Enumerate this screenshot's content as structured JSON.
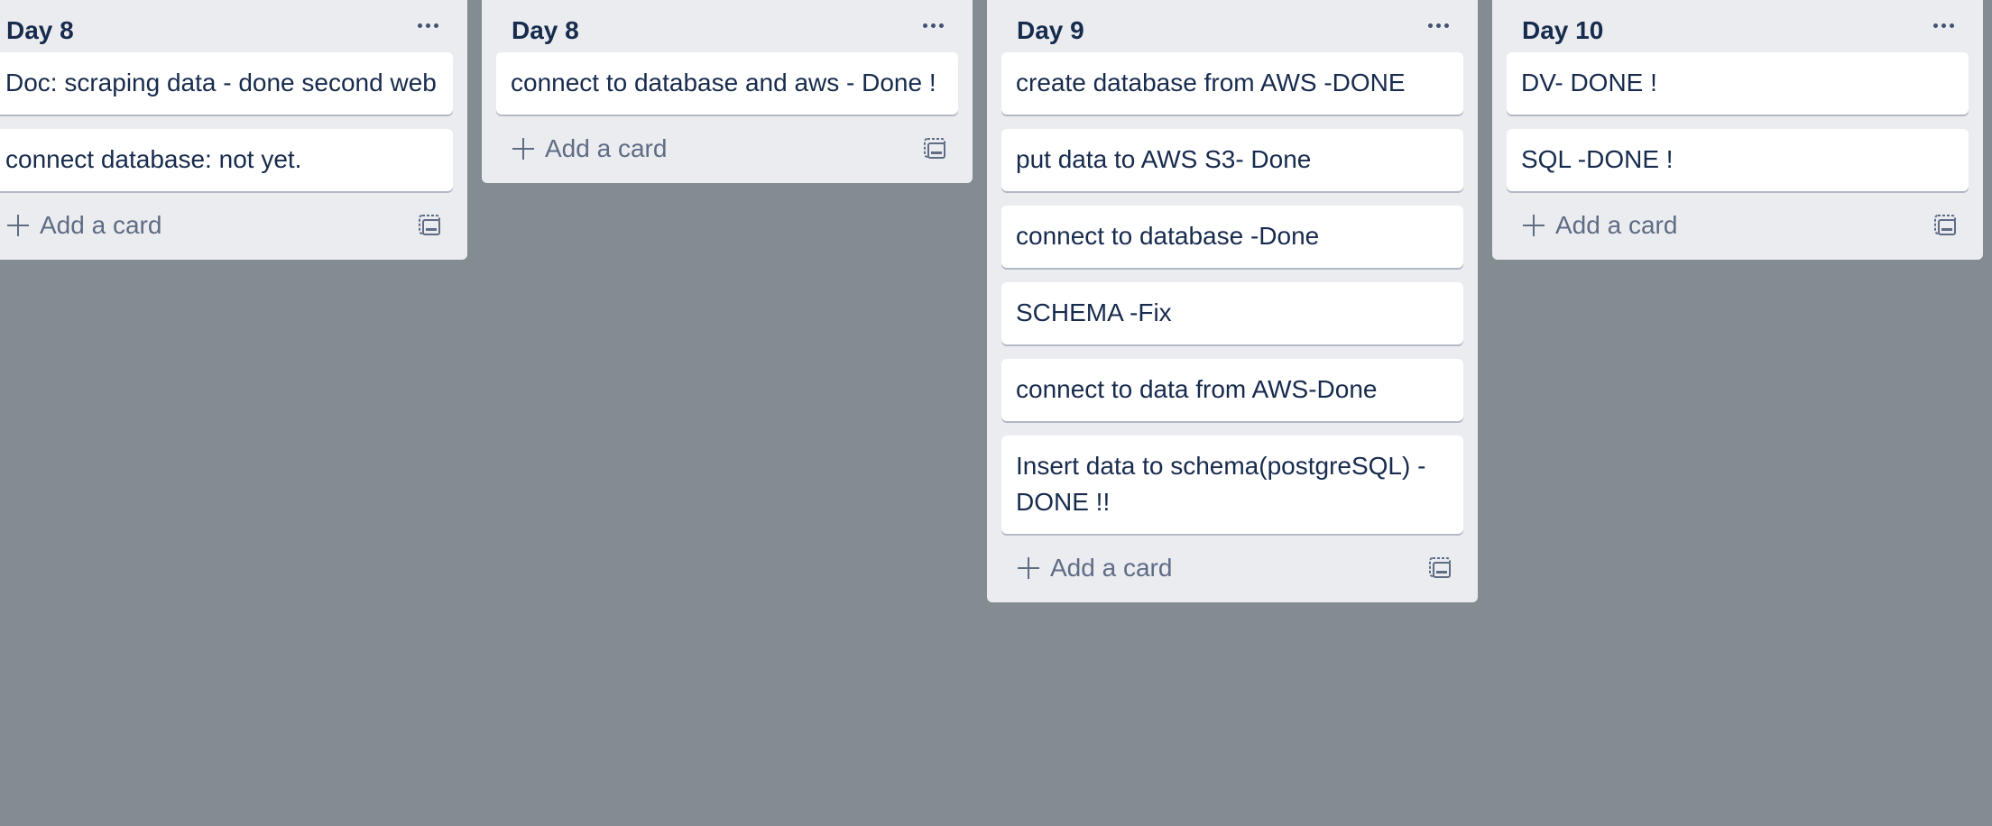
{
  "lists": [
    {
      "title": "Day 8",
      "cards": [
        "Doc: scraping data - done second web",
        "connect database: not yet."
      ],
      "add_label": "Add a card"
    },
    {
      "title": "Day 8",
      "cards": [
        "connect to database and aws - Done !"
      ],
      "add_label": "Add a card"
    },
    {
      "title": "Day 9",
      "cards": [
        "create database from AWS -DONE",
        "put data to AWS S3- Done",
        "connect to database -Done",
        "SCHEMA -Fix",
        "connect to data from AWS-Done",
        "Insert data to schema(postgreSQL) - DONE !!"
      ],
      "add_label": "Add a card"
    },
    {
      "title": "Day 10",
      "cards": [
        "DV- DONE !",
        "SQL -DONE !"
      ],
      "add_label": "Add a card"
    }
  ],
  "icons": {
    "list_menu": "more-horizontal-icon",
    "add": "plus-icon",
    "template": "card-template-icon"
  },
  "colors": {
    "board_background": "#838c91",
    "list_background": "#ebecf0",
    "card_background": "#ffffff",
    "text": "#172b4d",
    "muted_text": "#5e6c84"
  }
}
